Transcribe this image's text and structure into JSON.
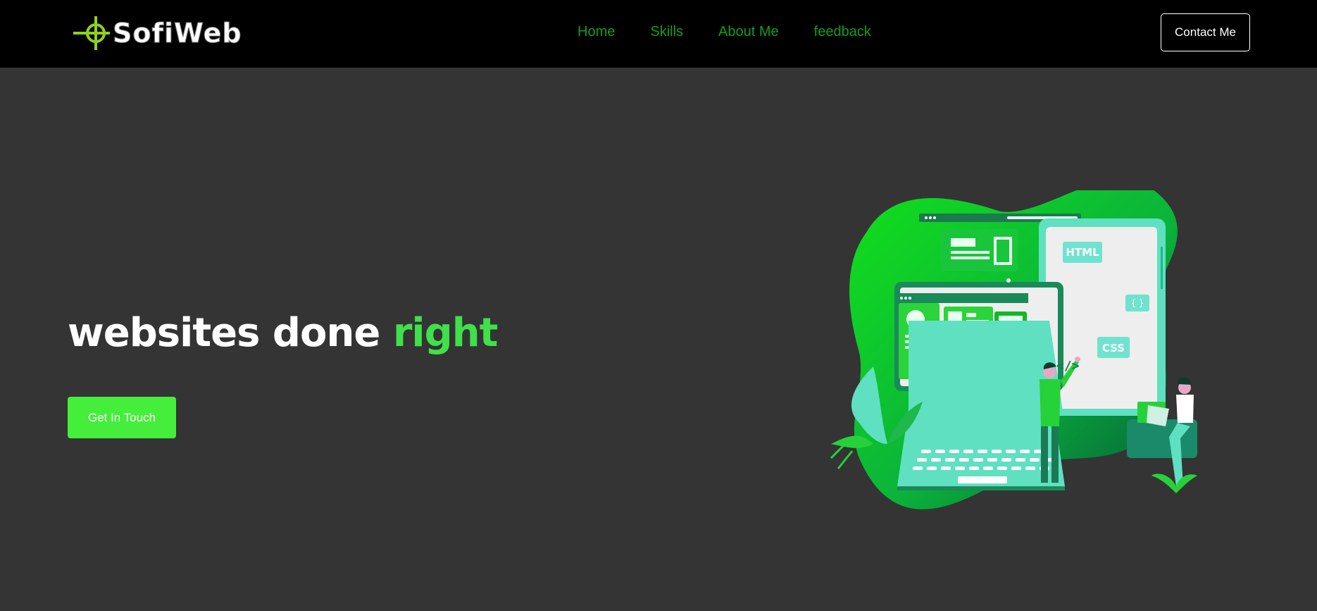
{
  "brand": {
    "name": "SofiWeb",
    "logo_color": "#8fd11f"
  },
  "nav": {
    "items": [
      {
        "label": "Home"
      },
      {
        "label": "Skills"
      },
      {
        "label": "About Me"
      },
      {
        "label": "feedback"
      }
    ],
    "contact_label": "Contact Me",
    "link_color": "#169c1f"
  },
  "hero": {
    "title_main": "websites done",
    "title_accent": "right",
    "accent_color": "#3fe04a",
    "cta_label": "Get In Touch",
    "cta_color": "#44ee3a"
  },
  "illustration": {
    "badge_html": "HTML",
    "badge_css": "CSS",
    "badge_braces": "{ }",
    "code_tag": "</>",
    "icon": "developer-illustration"
  }
}
